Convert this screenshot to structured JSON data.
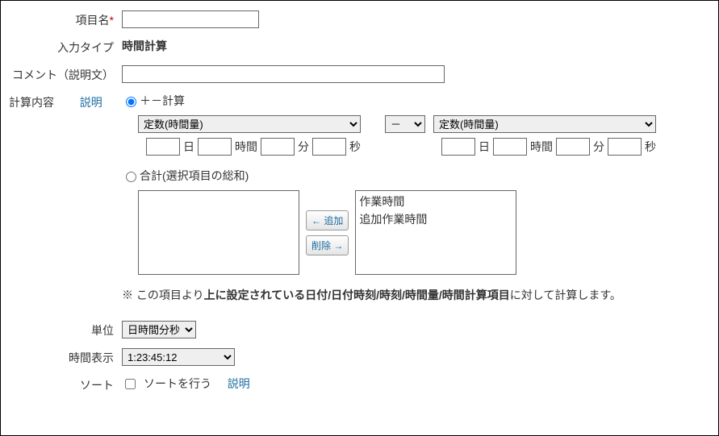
{
  "labels": {
    "name": "項目名",
    "required": "*",
    "inputType": "入力タイプ",
    "comment": "コメント（説明文）",
    "calcContent": "計算内容",
    "explain": "説明",
    "unit": "単位",
    "timeDisplay": "時間表示",
    "sort": "ソート"
  },
  "inputTypeValue": "時間計算",
  "calc": {
    "radioPlusMinus": "＋－計算",
    "radioSum": "合計(選択項目の総和)",
    "select1": "定数(時間量)",
    "opSelect": "－",
    "select2": "定数(時間量)",
    "unitDay": "日",
    "unitHour": "時間",
    "unitMin": "分",
    "unitSec": "秒",
    "addBtn": "← 追加",
    "removeBtn": "削除 →",
    "listItems": [
      "作業時間",
      "追加作業時間"
    ],
    "note_prefix": "※ この項目より",
    "note_bold": "上に設定されている日付/日付時刻/時刻/時間量/時間計算項目",
    "note_suffix": "に対して計算します。"
  },
  "unitSelect": "日時間分秒",
  "timeDisplaySelect": "1:23:45:12",
  "sortCheckbox": "ソートを行う"
}
